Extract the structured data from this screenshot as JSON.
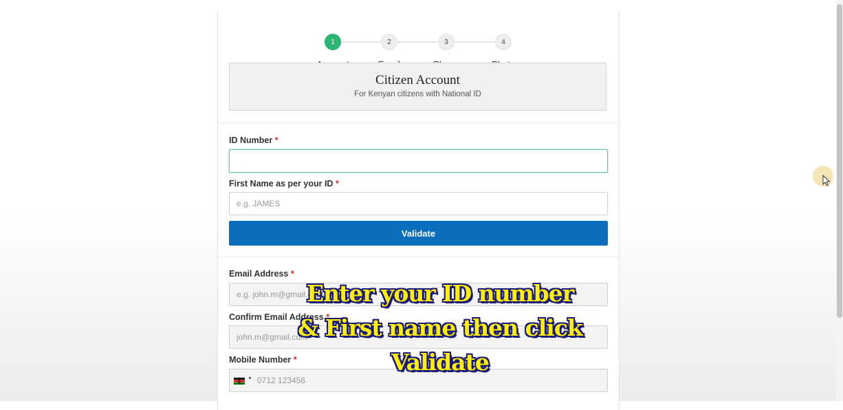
{
  "stepper": {
    "steps": [
      {
        "number": "1",
        "label": "Account",
        "active": true
      },
      {
        "number": "2",
        "label": "Email",
        "active": false
      },
      {
        "number": "3",
        "label": "Phone",
        "active": false
      },
      {
        "number": "4",
        "label": "Photo",
        "active": false
      }
    ]
  },
  "account_card": {
    "title": "Citizen Account",
    "subtitle": "For Kenyan citizens with National ID"
  },
  "form": {
    "id_number": {
      "label": "ID Number",
      "required_mark": "*",
      "value": "",
      "placeholder": ""
    },
    "first_name": {
      "label": "First Name as per your ID",
      "required_mark": "*",
      "value": "",
      "placeholder": "e.g. JAMES"
    },
    "validate_label": "Validate",
    "email": {
      "label": "Email Address",
      "required_mark": "*",
      "placeholder": "e.g. john.m@gmail.com"
    },
    "confirm_email": {
      "label": "Confirm Email Address",
      "required_mark": "*",
      "placeholder": "john.m@gmail.com"
    },
    "mobile": {
      "label": "Mobile Number",
      "required_mark": "*",
      "placeholder": "0712 123456",
      "country_flag": "kenya-flag-icon"
    }
  },
  "overlay": {
    "line1": "Enter your ID number",
    "line2": "& First name then click",
    "line3": "Validate"
  },
  "colors": {
    "active_step": "#2bb673",
    "primary_button": "#0a6ebd",
    "required": "#d32f2f",
    "caption_text": "#fff000",
    "caption_outline": "#1a1a7a"
  }
}
